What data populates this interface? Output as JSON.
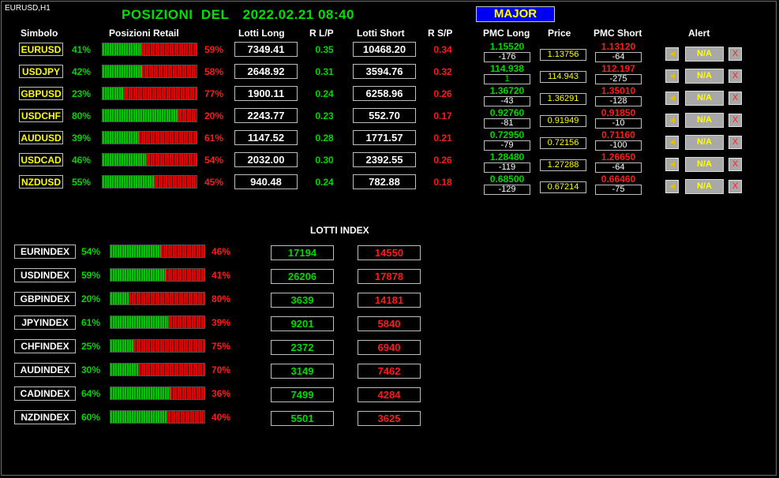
{
  "window_title": "EURUSD,H1",
  "title": {
    "prefix": "POSIZIONI  DEL",
    "datetime": "2022.02.21 08:40"
  },
  "major_button": "MAJOR",
  "headers": {
    "simbolo": "Simbolo",
    "posizioni_retail": "Posizioni Retail",
    "lotti_long": "Lotti Long",
    "r_lp": "R L/P",
    "lotti_short": "Lotti Short",
    "r_sp": "R S/P",
    "pmc_long": "PMC Long",
    "price": "Price",
    "pmc_short": "PMC Short",
    "alert": "Alert"
  },
  "pairs": [
    {
      "symbol": "EURUSD",
      "long_pct": "41%",
      "long_frac": 0.41,
      "short_pct": "59%",
      "lotti_long": "7349.41",
      "r_lp": "0.35",
      "lotti_short": "10468.20",
      "r_sp": "0.34",
      "pmc_long": "1.15520",
      "pmc_long_diff": "-176",
      "price": "1.13756",
      "pmc_short": "1.13120",
      "pmc_short_diff": "-64",
      "na": "N/A",
      "x": "X"
    },
    {
      "symbol": "USDJPY",
      "long_pct": "42%",
      "long_frac": 0.42,
      "short_pct": "58%",
      "lotti_long": "2648.92",
      "r_lp": "0.31",
      "lotti_short": "3594.76",
      "r_sp": "0.32",
      "pmc_long": "114.938",
      "pmc_long_diff": "1",
      "price": "114.943",
      "pmc_short": "112.197",
      "pmc_short_diff": "-275",
      "na": "N/A",
      "x": "X"
    },
    {
      "symbol": "GBPUSD",
      "long_pct": "23%",
      "long_frac": 0.23,
      "short_pct": "77%",
      "lotti_long": "1900.11",
      "r_lp": "0.24",
      "lotti_short": "6258.96",
      "r_sp": "0.26",
      "pmc_long": "1.36720",
      "pmc_long_diff": "-43",
      "price": "1.36291",
      "pmc_short": "1.35010",
      "pmc_short_diff": "-128",
      "na": "N/A",
      "x": "X"
    },
    {
      "symbol": "USDCHF",
      "long_pct": "80%",
      "long_frac": 0.8,
      "short_pct": "20%",
      "lotti_long": "2243.77",
      "r_lp": "0.23",
      "lotti_short": "552.70",
      "r_sp": "0.17",
      "pmc_long": "0.92760",
      "pmc_long_diff": "-81",
      "price": "0.91949",
      "pmc_short": "0.91850",
      "pmc_short_diff": "-10",
      "na": "N/A",
      "x": "X"
    },
    {
      "symbol": "AUDUSD",
      "long_pct": "39%",
      "long_frac": 0.39,
      "short_pct": "61%",
      "lotti_long": "1147.52",
      "r_lp": "0.28",
      "lotti_short": "1771.57",
      "r_sp": "0.21",
      "pmc_long": "0.72950",
      "pmc_long_diff": "-79",
      "price": "0.72156",
      "pmc_short": "0.71160",
      "pmc_short_diff": "-100",
      "na": "N/A",
      "x": "X"
    },
    {
      "symbol": "USDCAD",
      "long_pct": "46%",
      "long_frac": 0.46,
      "short_pct": "54%",
      "lotti_long": "2032.00",
      "r_lp": "0.30",
      "lotti_short": "2392.55",
      "r_sp": "0.26",
      "pmc_long": "1.28480",
      "pmc_long_diff": "-119",
      "price": "1.27288",
      "pmc_short": "1.26650",
      "pmc_short_diff": "-64",
      "na": "N/A",
      "x": "X"
    },
    {
      "symbol": "NZDUSD",
      "long_pct": "55%",
      "long_frac": 0.55,
      "short_pct": "45%",
      "lotti_long": "940.48",
      "r_lp": "0.24",
      "lotti_short": "782.88",
      "r_sp": "0.18",
      "pmc_long": "0.68500",
      "pmc_long_diff": "-129",
      "price": "0.67214",
      "pmc_short": "0.66460",
      "pmc_short_diff": "-75",
      "na": "N/A",
      "x": "X"
    }
  ],
  "lotti_index_title": "LOTTI INDEX",
  "indexes": [
    {
      "name": "EURINDEX",
      "long_pct": "54%",
      "long_frac": 0.54,
      "short_pct": "46%",
      "long": "17194",
      "short": "14550"
    },
    {
      "name": "USDINDEX",
      "long_pct": "59%",
      "long_frac": 0.59,
      "short_pct": "41%",
      "long": "26206",
      "short": "17878"
    },
    {
      "name": "GBPINDEX",
      "long_pct": "20%",
      "long_frac": 0.2,
      "short_pct": "80%",
      "long": "3639",
      "short": "14181"
    },
    {
      "name": "JPYINDEX",
      "long_pct": "61%",
      "long_frac": 0.61,
      "short_pct": "39%",
      "long": "9201",
      "short": "5840"
    },
    {
      "name": "CHFINDEX",
      "long_pct": "25%",
      "long_frac": 0.25,
      "short_pct": "75%",
      "long": "2372",
      "short": "6940"
    },
    {
      "name": "AUDINDEX",
      "long_pct": "30%",
      "long_frac": 0.3,
      "short_pct": "70%",
      "long": "3149",
      "short": "7462"
    },
    {
      "name": "CADINDEX",
      "long_pct": "64%",
      "long_frac": 0.64,
      "short_pct": "36%",
      "long": "7499",
      "short": "4284"
    },
    {
      "name": "NZDINDEX",
      "long_pct": "60%",
      "long_frac": 0.6,
      "short_pct": "40%",
      "long": "5501",
      "short": "3625"
    }
  ],
  "colors": {
    "long": "#00d800",
    "short": "#ff1a1a",
    "symbol": "#ffff00",
    "title": "#00e000",
    "major_bg": "#0000f0"
  }
}
